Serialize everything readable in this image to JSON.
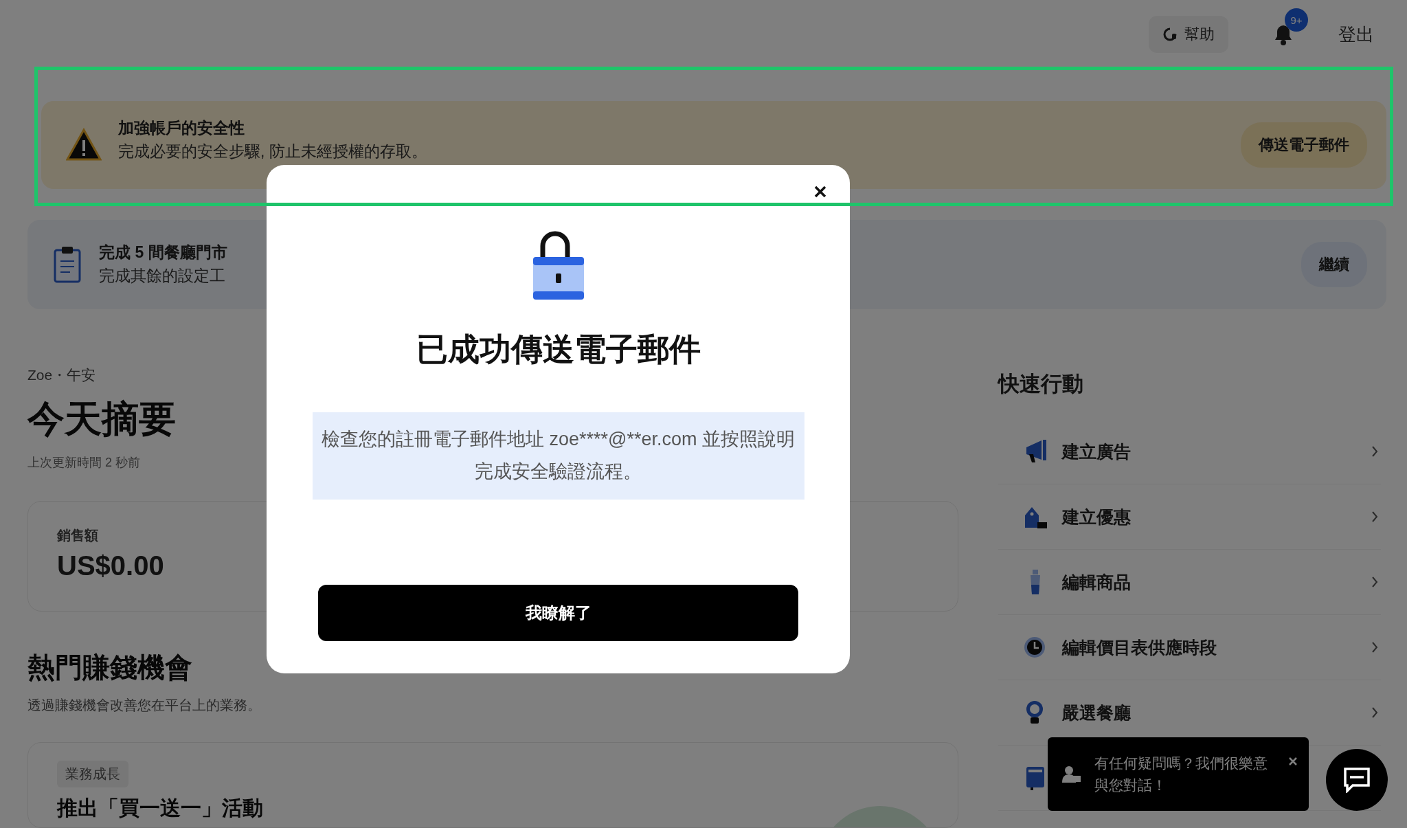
{
  "header": {
    "help": "幫助",
    "notifications_badge": "9+",
    "logout": "登出"
  },
  "security_banner": {
    "title": "加強帳戶的安全性",
    "message": "完成必要的安全步驟, 防止未經授權的存取。",
    "button": "傳送電子郵件"
  },
  "setup_banner": {
    "title": "完成 5 間餐廳門市",
    "message": "完成其餘的設定工",
    "button": "繼續"
  },
  "summary": {
    "greeting": "Zoe・午安",
    "title": "今天摘要",
    "updated": "上次更新時間 2 秒前",
    "sales_label": "銷售額",
    "sales_value": "US$0.00"
  },
  "opportunities": {
    "title": "熱門賺錢機會",
    "subtitle": "透過賺錢機會改善您在平台上的業務。",
    "card": {
      "tag": "業務成長",
      "title": "推出「買一送一」活動"
    }
  },
  "quick_actions": {
    "title": "快速行動",
    "items": [
      {
        "kind": "ad",
        "label": "建立廣告"
      },
      {
        "kind": "offer",
        "label": "建立優惠"
      },
      {
        "kind": "item",
        "label": "編輯商品"
      },
      {
        "kind": "schedule",
        "label": "編輯價目表供應時段"
      },
      {
        "kind": "featured",
        "label": "嚴選餐廳"
      },
      {
        "kind": "store"
      }
    ]
  },
  "chat": {
    "tooltip": "有任何疑問嗎？我們很樂意與您對話！"
  },
  "modal": {
    "title": "已成功傳送電子郵件",
    "message": "檢查您的註冊電子郵件地址 zoe****@**er.com 並按照說明完成安全驗證流程。",
    "button": "我瞭解了"
  },
  "annotation_frame": {
    "visible": true
  }
}
